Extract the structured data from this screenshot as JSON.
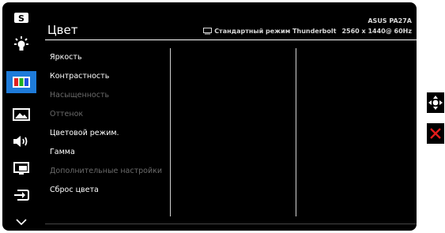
{
  "header": {
    "title": "Цвет",
    "model": "ASUS PA27A",
    "mode": "Стандартный режим Thunderbolt",
    "resolution": "2560 x 1440@ 60Hz"
  },
  "sidebar": {
    "items": [
      {
        "name": "splendid-icon",
        "active": false
      },
      {
        "name": "blue-light-filter-icon",
        "active": false
      },
      {
        "name": "color-icon",
        "active": true
      },
      {
        "name": "image-icon",
        "active": false
      },
      {
        "name": "sound-icon",
        "active": false
      },
      {
        "name": "pip-icon",
        "active": false
      },
      {
        "name": "input-select-icon",
        "active": false
      },
      {
        "name": "chevron-down-icon",
        "active": false
      }
    ]
  },
  "menu": {
    "items": [
      {
        "label": "Яркость",
        "enabled": true
      },
      {
        "label": "Контрастность",
        "enabled": true
      },
      {
        "label": "Насыщенность",
        "enabled": false
      },
      {
        "label": "Оттенок",
        "enabled": false
      },
      {
        "label": "Цветовой режим.",
        "enabled": true
      },
      {
        "label": "Гамма",
        "enabled": true
      },
      {
        "label": "Дополнительные настройки",
        "enabled": false
      },
      {
        "label": "Сброс цвета",
        "enabled": true
      }
    ]
  },
  "controls": {
    "navigate": "navigation-joystick-icon",
    "close": "close-icon"
  },
  "colors": {
    "active": "#1e7bd9",
    "close": "#e21c1c",
    "background": "#000000",
    "text": "#ffffff",
    "disabled_text": "#6b6b6b"
  }
}
